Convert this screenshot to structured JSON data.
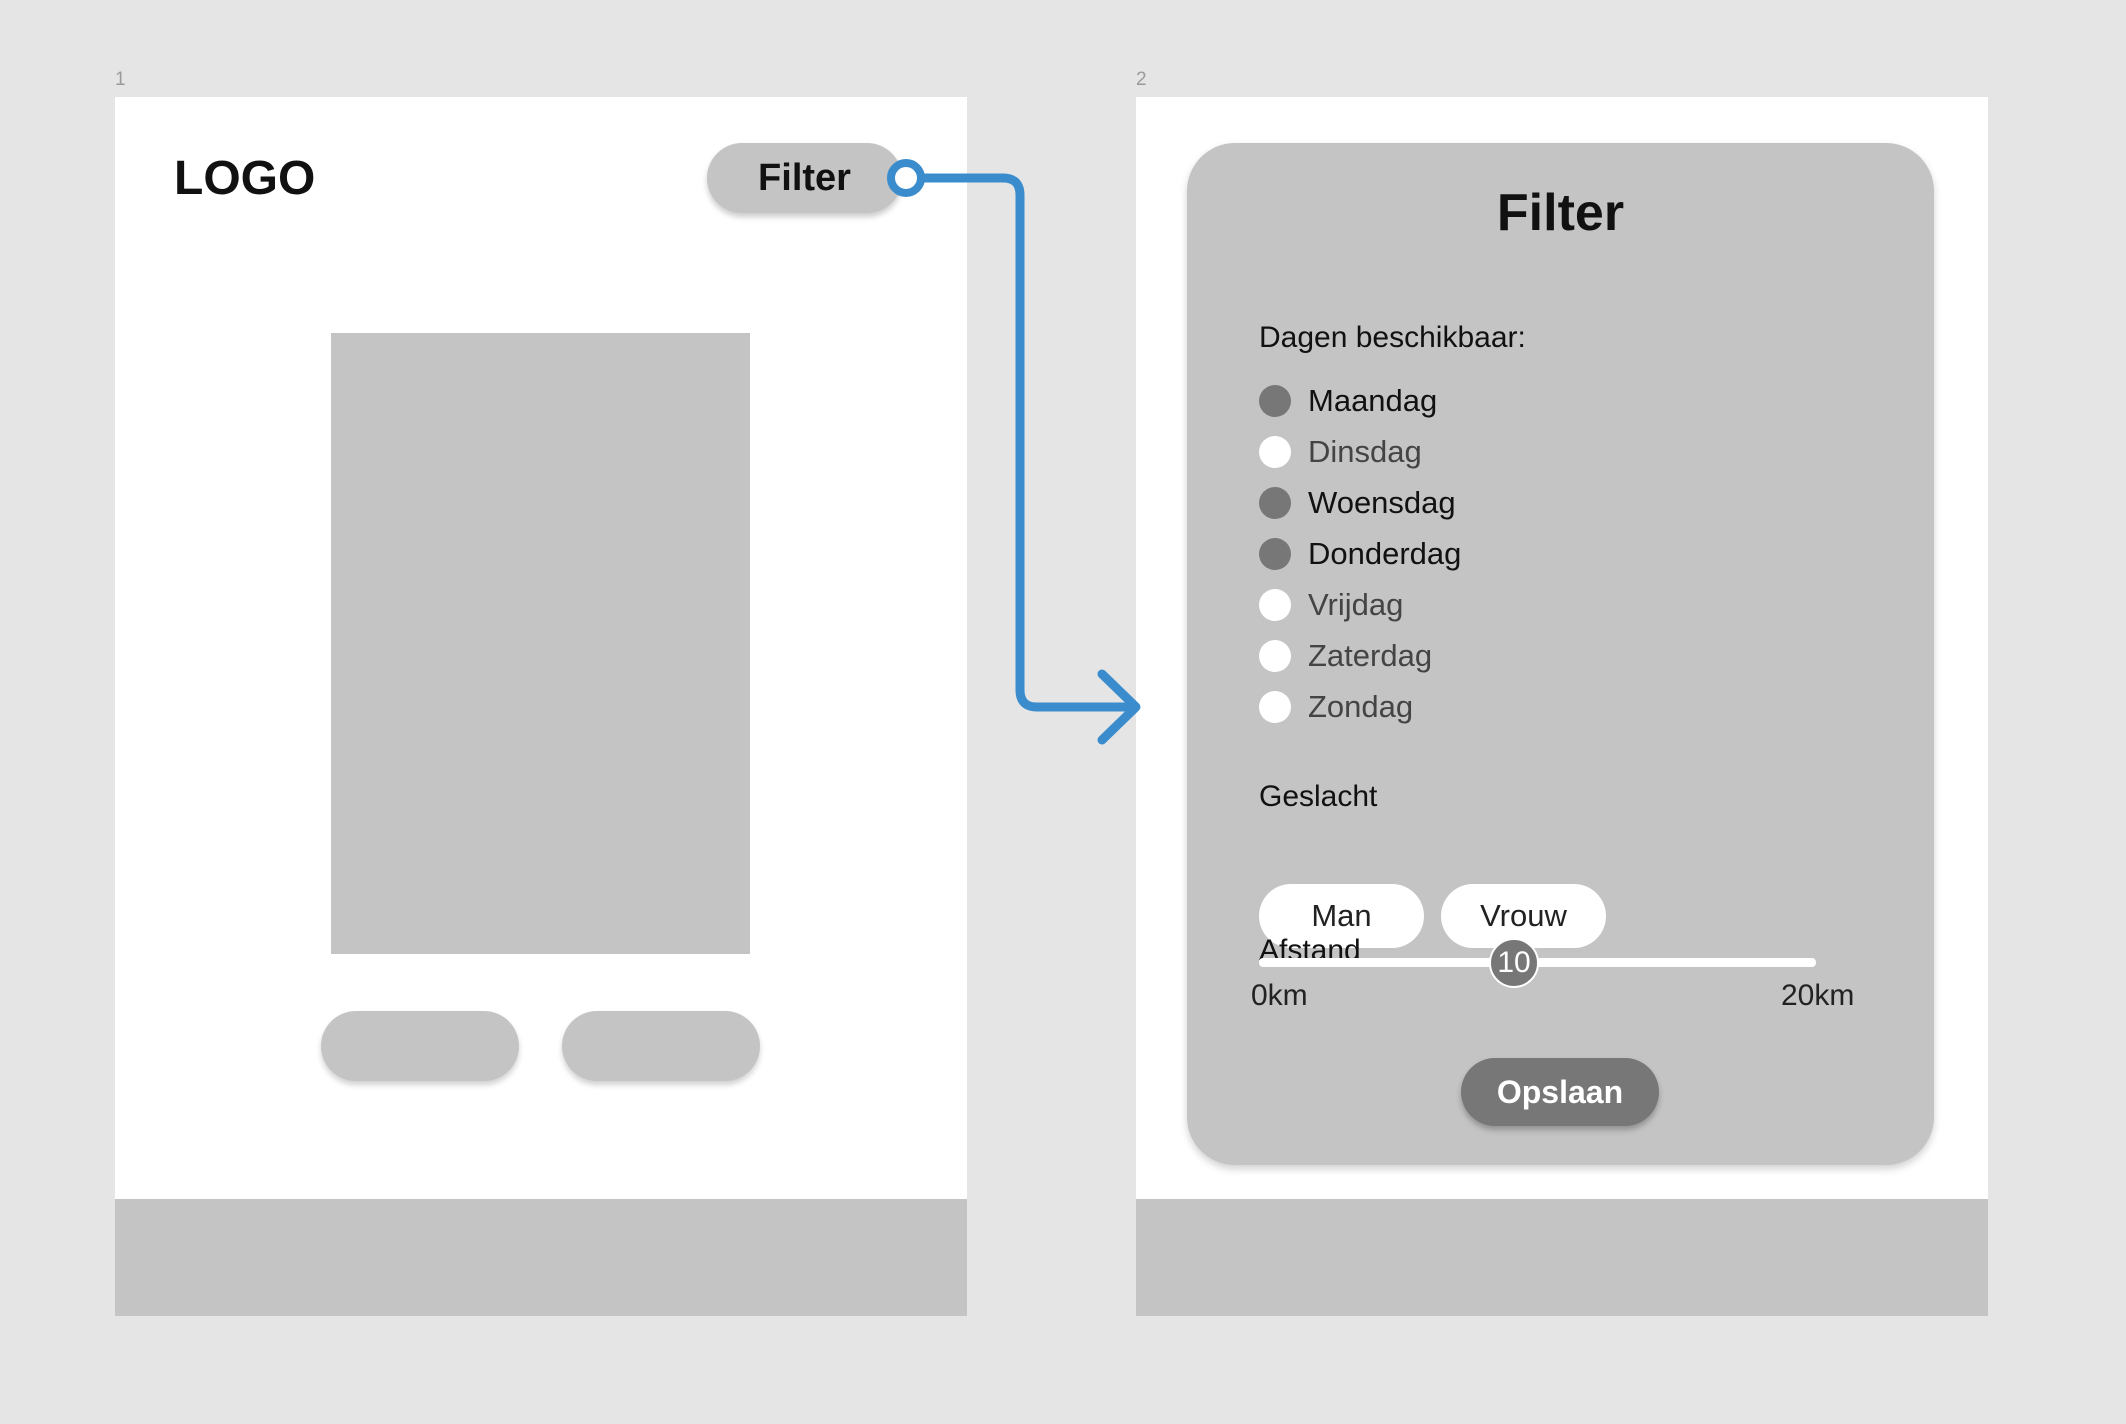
{
  "frames": [
    {
      "number": "1"
    },
    {
      "number": "2"
    }
  ],
  "screen1": {
    "logo": "LOGO",
    "filter_button": "Filter"
  },
  "filter_panel": {
    "title": "Filter",
    "days_label": "Dagen beschikbaar:",
    "days": [
      {
        "label": "Maandag",
        "selected": true
      },
      {
        "label": "Dinsdag",
        "selected": false
      },
      {
        "label": "Woensdag",
        "selected": true
      },
      {
        "label": "Donderdag",
        "selected": true
      },
      {
        "label": "Vrijdag",
        "selected": false
      },
      {
        "label": "Zaterdag",
        "selected": false
      },
      {
        "label": "Zondag",
        "selected": false
      }
    ],
    "gender_label": "Geslacht",
    "gender_options": [
      "Man",
      "Vrouw"
    ],
    "distance_label": "Afstand",
    "distance": {
      "value": "10",
      "min_label": "0km",
      "max_label": "20km",
      "min": 0,
      "max": 20
    },
    "save_button": "Opslaan"
  },
  "colors": {
    "background": "#e5e5e5",
    "placeholder": "#c4c4c4",
    "selected": "#777777",
    "connector": "#3a8ccc"
  },
  "icons": {
    "connector": "flow-arrow-icon"
  }
}
